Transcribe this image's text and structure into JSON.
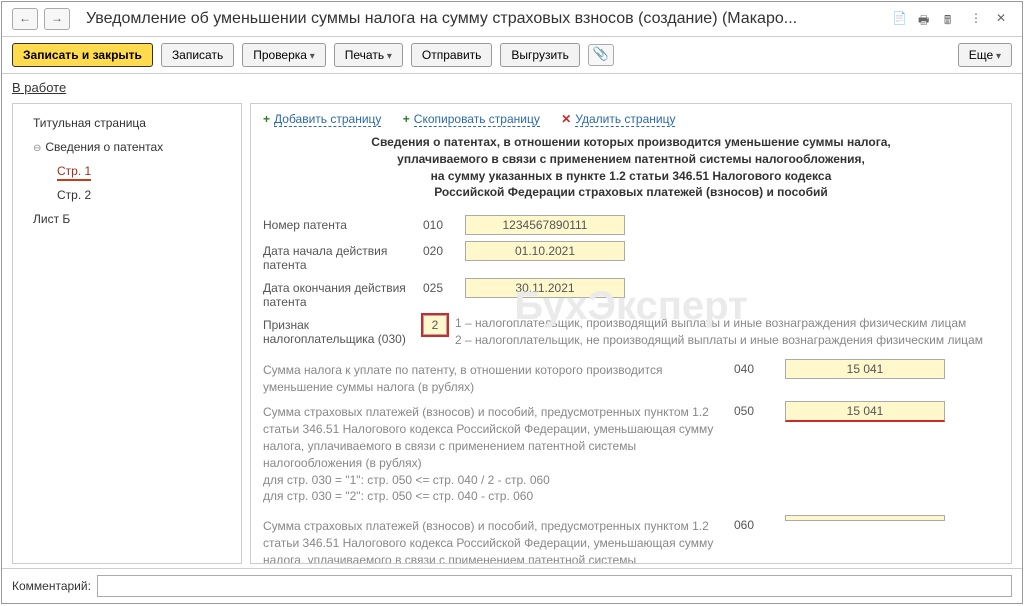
{
  "header": {
    "title": "Уведомление об уменьшении суммы налога на сумму страховых взносов (создание) (Макаро..."
  },
  "toolbar": {
    "save_close": "Записать и закрыть",
    "save": "Записать",
    "check": "Проверка",
    "print": "Печать",
    "send": "Отправить",
    "export": "Выгрузить",
    "more": "Еще"
  },
  "tabs": {
    "active": "В работе"
  },
  "sidebar": {
    "items": [
      "Титульная страница",
      "Сведения о патентах",
      "Стр. 1",
      "Стр. 2",
      "Лист Б"
    ]
  },
  "page_actions": {
    "add": "Добавить страницу",
    "copy": "Скопировать страницу",
    "delete": "Удалить страницу"
  },
  "form": {
    "heading_l1": "Сведения о патентах, в отношении которых производится уменьшение суммы налога,",
    "heading_l2": "уплачиваемого в связи с применением патентной системы налогообложения,",
    "heading_l3": "на сумму указанных в пункте 1.2 статьи 346.51 Налогового кодекса",
    "heading_l4": "Российской Федерации страховых платежей (взносов) и пособий",
    "r010": {
      "label": "Номер патента",
      "code": "010",
      "value": "1234567890111"
    },
    "r020": {
      "label": "Дата начала действия патента",
      "code": "020",
      "value": "01.10.2021"
    },
    "r025": {
      "label": "Дата окончания действия патента",
      "code": "025",
      "value": "30.11.2021"
    },
    "r030": {
      "label": "Признак налогоплательщика (030)",
      "value": "2",
      "desc1": "1 – налогоплательщик, производящий выплаты и иные вознаграждения физическим лицам",
      "desc2": "2 – налогоплательщик, не производящий выплаты и иные вознаграждения физическим лицам"
    },
    "r040": {
      "label": "Сумма налога к уплате по патенту, в отношении которого производится уменьшение суммы налога (в рублях)",
      "code": "040",
      "value": "15 041"
    },
    "r050": {
      "label": "Сумма страховых платежей (взносов) и пособий, предусмотренных пунктом 1.2 статьи 346.51 Налогового кодекса Российской Федерации, уменьшающая сумму налога, уплачиваемого в связи с применением патентной системы налогообложения (в рублях)\nдля стр. 030 = \"1\": стр. 050 <= стр. 040 / 2 - стр. 060\nдля стр. 030 = \"2\": стр. 050 <= стр. 040 - стр. 060",
      "code": "050",
      "value": "15 041"
    },
    "r060": {
      "label": "Сумма страховых платежей (взносов) и пособий, предусмотренных пунктом 1.2 статьи 346.51 Налогового кодекса Российской Федерации, уменьшающая сумму налога, уплачиваемого в связи с применением патентной системы налогообложения, которая была учтена при уменьшении суммы налога в ранее представленных уведомлениях (в рублях)",
      "code": "060",
      "value": ""
    }
  },
  "footer": {
    "label": "Комментарий:",
    "value": ""
  },
  "watermark": "БухЭксперт"
}
